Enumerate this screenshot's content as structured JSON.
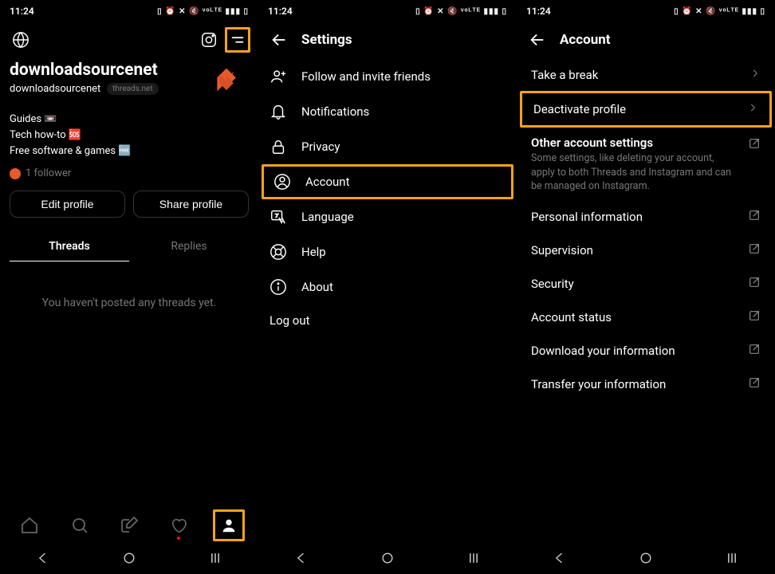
{
  "status": {
    "time": "11:24",
    "icons": "▯ ⏰ ✕ 🔇 ᵛᵒᴸᵀᴱ ▮▮▮ ▯"
  },
  "profile": {
    "display_name": "downloadsourcenet",
    "handle": "downloadsourcenet",
    "domain_pill": "threads.net",
    "bio": {
      "l1": "Guides 📼",
      "l2": "Tech how-to 🆘",
      "l3": "Free software & games 🆓"
    },
    "followers_label": "1 follower",
    "edit_btn": "Edit profile",
    "share_btn": "Share profile",
    "tab_threads": "Threads",
    "tab_replies": "Replies",
    "empty_msg": "You haven't posted any threads yet."
  },
  "settings": {
    "title": "Settings",
    "items": {
      "invite": "Follow and invite friends",
      "notifications": "Notifications",
      "privacy": "Privacy",
      "account": "Account",
      "language": "Language",
      "help": "Help",
      "about": "About",
      "logout": "Log out"
    }
  },
  "account": {
    "title": "Account",
    "take_break": "Take a break",
    "deactivate": "Deactivate profile",
    "other_head": "Other account settings",
    "other_desc": "Some settings, like deleting your account, apply to both Threads and Instagram and can be managed on Instagram.",
    "personal": "Personal information",
    "supervision": "Supervision",
    "security": "Security",
    "status": "Account status",
    "download": "Download your information",
    "transfer": "Transfer your information"
  }
}
